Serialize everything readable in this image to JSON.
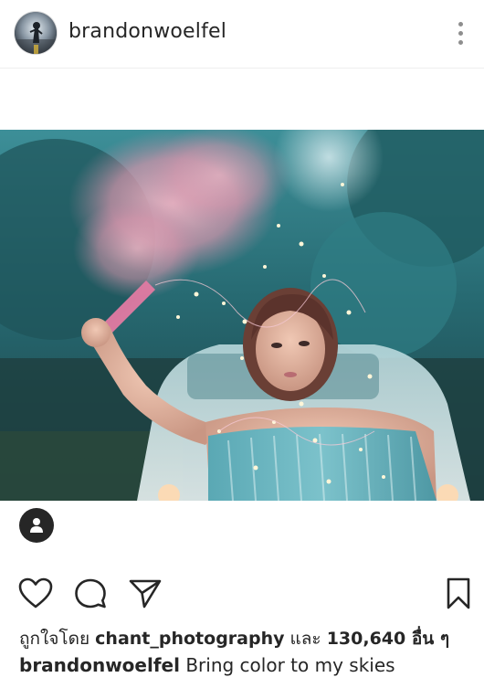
{
  "post": {
    "username": "brandonwoelfel",
    "avatar_icon": "profile-photo-avatar",
    "more_icon": "more-vertical-icon",
    "tag_icon": "person-tag-icon",
    "actions": {
      "like_icon": "heart-icon",
      "comment_icon": "comment-icon",
      "share_icon": "send-icon",
      "save_icon": "bookmark-icon"
    },
    "likes": {
      "prefix": "ถูกใจโดย",
      "liker": "chant_photography",
      "joiner": "และ",
      "others": "130,640 อื่น ๆ"
    },
    "caption": {
      "username": "brandonwoelfel",
      "text": "Bring color to my skies"
    }
  },
  "colors": {
    "text": "#262626",
    "secondary": "#8e8e8e",
    "divider": "#efefef",
    "photo_teal": "#2b7f86",
    "smoke_pink": "#e8a3b6"
  }
}
